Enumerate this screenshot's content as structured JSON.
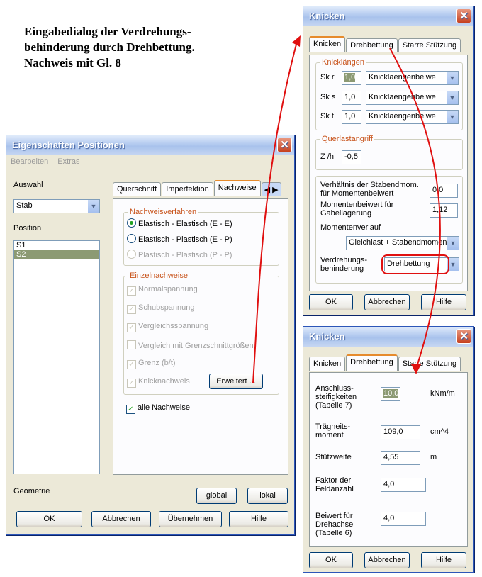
{
  "heading": {
    "line1": "Eingabedialog der Verdrehungs-",
    "line2": "behinderung durch Drehbettung.",
    "line3": "Nachweis mit Gl. 8"
  },
  "eig": {
    "title": "Eigenschaften Positionen",
    "menu": [
      "Bearbeiten",
      "Extras"
    ],
    "auswahl_label": "Auswahl",
    "auswahl_value": "Stab",
    "position_label": "Position",
    "positions": [
      "S1",
      "S2"
    ],
    "tabs": [
      "Querschnitt",
      "Imperfektion",
      "Nachweise"
    ],
    "nachweisverfahren_label": "Nachweisverfahren",
    "radios": [
      "Elastisch - Elastisch (E - E)",
      "Elastisch - Plastisch (E - P)",
      "Plastisch - Plastisch (P - P)"
    ],
    "einzel_label": "Einzelnachweise",
    "checks": [
      "Normalspannung",
      "Schubspannung",
      "Vergleichsspannung",
      "Vergleich mit Grenzschnittgrößen",
      "Grenz (b/t)",
      "Knicknachweis"
    ],
    "erweitert": "Erweitert ...",
    "alle": "alle Nachweise",
    "geometrie": "Geometrie",
    "global": "global",
    "lokal": "lokal",
    "ok": "OK",
    "abbrechen": "Abbrechen",
    "uebernehmen": "Übernehmen",
    "hilfe": "Hilfe"
  },
  "k1": {
    "title": "Knicken",
    "tabs": [
      "Knicken",
      "Drehbettung",
      "Starre Stützung"
    ],
    "knicklaengen_label": "Knicklängen",
    "rows": [
      {
        "label": "Sk r",
        "value": "1,0",
        "combo": "Knicklaengenbeiwe"
      },
      {
        "label": "Sk s",
        "value": "1,0",
        "combo": "Knicklaengenbeiwe"
      },
      {
        "label": "Sk t",
        "value": "1,0",
        "combo": "Knicklaengenbeiwe"
      }
    ],
    "querlast_label": "Querlastangriff",
    "zh_label": "Z /h",
    "zh_value": "-0,5",
    "verh_label": "Verhältnis der Stabendmom. für Momentenbeiwert",
    "verh_value": "0,0",
    "mom_label": "Momentenbeiwert für Gabellagerung",
    "mom_value": "1,12",
    "verlauf_label": "Momentenverlauf",
    "verlauf_value": "Gleichlast + Stabendmoment",
    "verdreh_label": "Verdrehungs- behinderung",
    "verdreh_value": "Drehbettung",
    "ok": "OK",
    "abbrechen": "Abbrechen",
    "hilfe": "Hilfe"
  },
  "k2": {
    "title": "Knicken",
    "tabs": [
      "Knicken",
      "Drehbettung",
      "Starre Stützung"
    ],
    "rows": [
      {
        "label": "Anschluss- steifigkeiten (Tabelle 7)",
        "value": "10,0",
        "unit": "kNm/m"
      },
      {
        "label": "Trägheits- moment",
        "value": "109,0",
        "unit": "cm^4"
      },
      {
        "label": "Stützweite",
        "value": "4,55",
        "unit": "m"
      },
      {
        "label": "Faktor der Feldanzahl",
        "value": "4,0",
        "unit": ""
      },
      {
        "label": "Beiwert für Drehachse (Tabelle 6)",
        "value": "4,0",
        "unit": ""
      }
    ],
    "ok": "OK",
    "abbrechen": "Abbrechen",
    "hilfe": "Hilfe"
  },
  "colors": {
    "arrow": "#e01010",
    "title_bar": "#a8c2ec"
  }
}
